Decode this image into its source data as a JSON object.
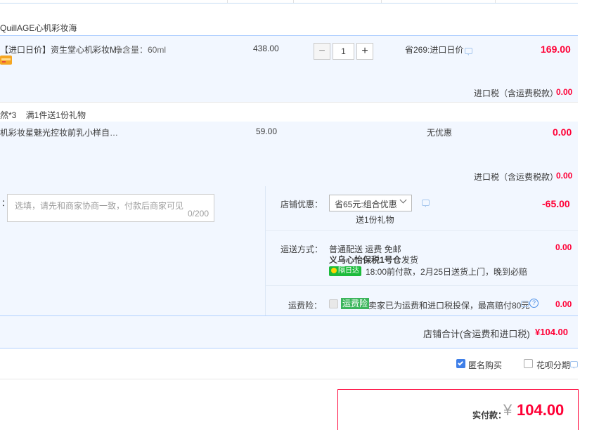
{
  "shop": {
    "name": "QuillAGE心机彩妆海"
  },
  "items": [
    {
      "title": "【进口日价】资生堂心机彩妆M…",
      "spec": "净含量：60ml",
      "price": "438.00",
      "quantity": "1",
      "promo": "省269:进口日价",
      "subtotal": "169.00",
      "tax_label": "进口税（含运费税款）",
      "tax_value": "0.00",
      "icons": [
        "credit-card-icon",
        "chat-icon"
      ]
    },
    {
      "gift_line": "然*3    满1件送1份礼物",
      "title": "机彩妆星魅光控妆前乳小样自…",
      "price": "59.00",
      "promo": "无优惠",
      "subtotal": "0.00",
      "tax_label": "进口税（含运费税款）",
      "tax_value": "0.00"
    }
  ],
  "message": {
    "colon": "：",
    "placeholder": "选填，请先和商家协商一致，付款后商家可见",
    "counter": "0/200"
  },
  "discount": {
    "label": "店铺优惠：",
    "selected": "省65元:组合优惠",
    "gift": "送1份礼物",
    "value": "-65.00"
  },
  "shipping": {
    "label": "运送方式：",
    "method": "普通配送 运费 免邮",
    "warehouse": "义乌心怡保税1号仓",
    "ship_word": "发货",
    "badge": "隔日达",
    "note": "18:00前付款，2月25日送货上门，晚到必赔",
    "value": "0.00"
  },
  "insurance": {
    "label": "运费险：",
    "tag": "运费险",
    "text": "卖家已为运费和进口税投保，最高赔付80元",
    "value": "0.00"
  },
  "shop_total": {
    "label": "店铺合计(含运费和进口税)",
    "value": "¥104.00"
  },
  "options": {
    "anonymous": "匿名购买",
    "huabei": "花呗分期"
  },
  "pay": {
    "label": "实付款：",
    "currency": "¥",
    "amount": "104.00"
  },
  "colors": {
    "accent_red": "#ff0036",
    "light_blue_bg": "#f2f7ff",
    "border_blue": "#b2d1ff"
  }
}
